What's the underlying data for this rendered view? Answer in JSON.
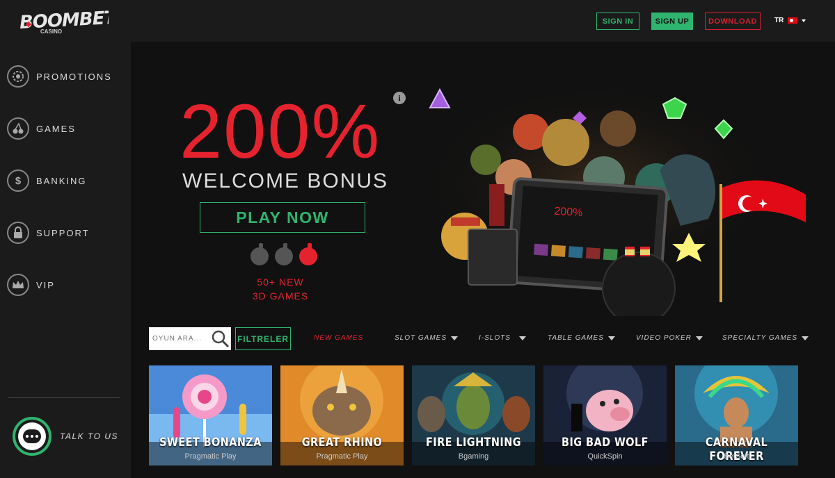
{
  "brand": {
    "logo_text": "BOOMBET",
    "logo_sub": "CASINO"
  },
  "header": {
    "signin_label": "SIGN IN",
    "signup_label": "SIGN UP",
    "download_label": "DOWNLOAD",
    "language": "TR"
  },
  "sidebar": {
    "items": [
      {
        "label": "PROMOTIONS",
        "icon": "chip-icon"
      },
      {
        "label": "GAMES",
        "icon": "cherry-icon"
      },
      {
        "label": "BANKING",
        "icon": "dollar-icon"
      },
      {
        "label": "SUPPORT",
        "icon": "lock-icon"
      },
      {
        "label": "VIP",
        "icon": "crown-icon"
      }
    ],
    "talk_label": "TALK TO US"
  },
  "hero": {
    "bonus_percent": "200%",
    "bonus_subtitle": "WELCOME BONUS",
    "cta_label": "PLAY NOW",
    "new_games_line1": "50+ NEW",
    "new_games_line2": "3D GAMES",
    "info_glyph": "i",
    "tablet_pct": "200%"
  },
  "filters": {
    "search_placeholder": "OYUN ARA...",
    "filter_button": "FILTRELER",
    "categories": [
      {
        "label": "NEW GAMES",
        "active": true
      },
      {
        "label": "SLOT GAMES",
        "dropdown": true
      },
      {
        "label": "I-SLOTS",
        "dropdown": true
      },
      {
        "label": "TABLE GAMES",
        "dropdown": true
      },
      {
        "label": "VIDEO POKER",
        "dropdown": true
      },
      {
        "label": "SPECIALTY GAMES",
        "dropdown": true
      }
    ]
  },
  "games": [
    {
      "title": "SWEET BONANZA",
      "provider": "Pragmatic Play"
    },
    {
      "title": "GREAT RHINO",
      "provider": "Pragmatic Play"
    },
    {
      "title": "FIRE LIGHTNING",
      "provider": "Bgaming"
    },
    {
      "title": "BIG BAD WOLF",
      "provider": "QuickSpin"
    },
    {
      "title": "CARNAVAL FOREVER",
      "provider": "BetSoft"
    }
  ],
  "colors": {
    "accent_green": "#2fb46f",
    "accent_red": "#e4232f",
    "bg": "#1b1b1b"
  }
}
